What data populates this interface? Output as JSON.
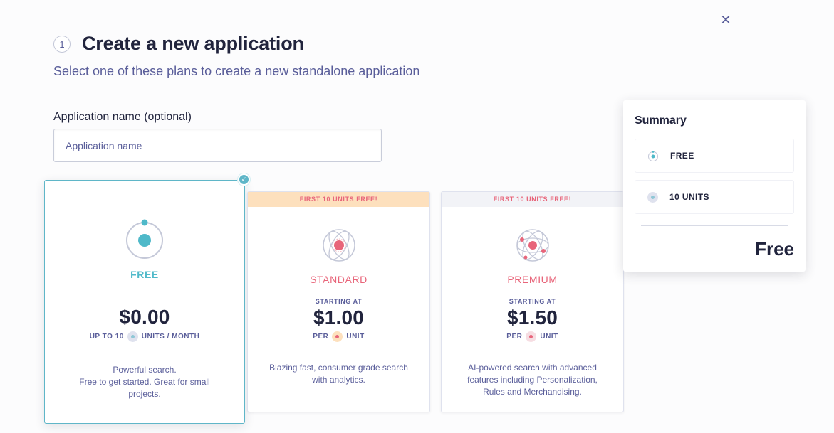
{
  "header": {
    "step_number": "1",
    "title": "Create a new application",
    "subtitle": "Select one of these plans to create a new standalone application"
  },
  "form": {
    "app_name_label": "Application name (optional)",
    "app_name_placeholder": "Application name",
    "app_name_value": ""
  },
  "plans": [
    {
      "name": "FREE",
      "banner": "",
      "starting_at": "",
      "price": "$0.00",
      "unit_prefix": "UP TO 10",
      "unit_suffix": "UNITS / MONTH",
      "description_lines": [
        "Powerful search.",
        "Free to get started. Great for small",
        "projects."
      ],
      "selected": true,
      "icon": "orbit-single-icon",
      "accent": "#4fb9c9"
    },
    {
      "name": "STANDARD",
      "banner": "FIRST 10 UNITS FREE!",
      "starting_at": "STARTING AT",
      "price": "$1.00",
      "unit_prefix": "PER",
      "unit_suffix": "UNIT",
      "description_lines": [
        "Blazing fast, consumer grade search",
        "with analytics."
      ],
      "selected": false,
      "icon": "atom-icon",
      "accent": "#e8657a",
      "banner_color": "#fde0bd"
    },
    {
      "name": "PREMIUM",
      "banner": "FIRST 10 UNITS FREE!",
      "starting_at": "STARTING AT",
      "price": "$1.50",
      "unit_prefix": "PER",
      "unit_suffix": "UNIT",
      "description_lines": [
        "AI-powered search with advanced",
        "features including Personalization,",
        "Rules and Merchandising."
      ],
      "selected": false,
      "icon": "atom-advanced-icon",
      "accent": "#e8657a",
      "banner_color": "#f2f3f7"
    }
  ],
  "summary": {
    "title": "Summary",
    "rows": [
      {
        "label": "FREE",
        "icon": "orbit-single-icon"
      },
      {
        "label": "10 UNITS",
        "icon": "unit-dot-icon"
      }
    ],
    "total": "Free"
  },
  "close": {
    "icon": "close-icon",
    "glyph": "✕"
  },
  "check": {
    "glyph": "✓"
  },
  "colors": {
    "accent_teal": "#4fb9c9",
    "accent_coral": "#e8657a",
    "text_primary": "#21243d",
    "text_secondary": "#5a5e9a"
  }
}
